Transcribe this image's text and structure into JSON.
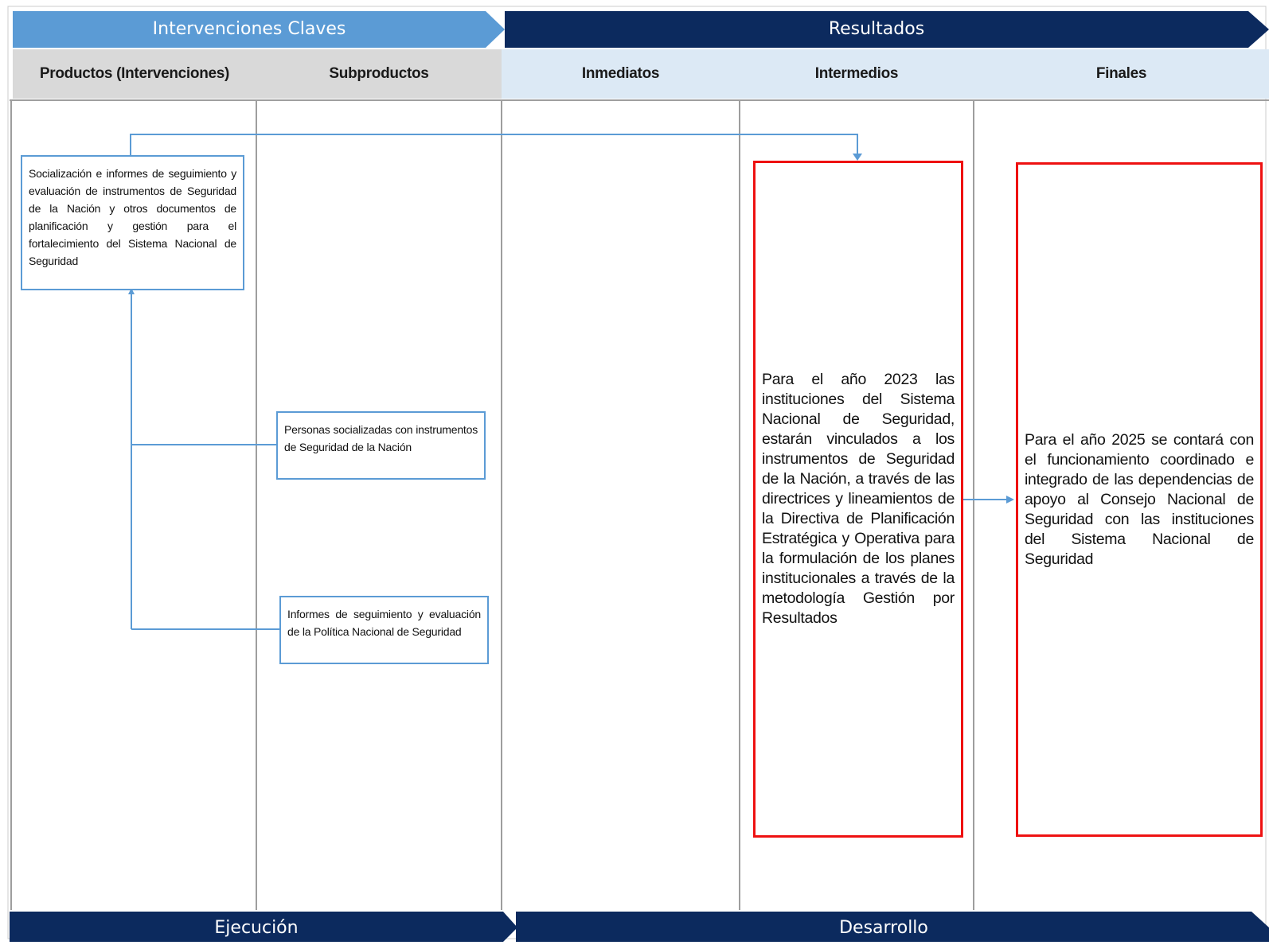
{
  "header": {
    "left_bar": "Intervenciones Claves",
    "right_bar": "Resultados"
  },
  "columns": {
    "productos": "Productos (Intervenciones)",
    "subproductos": "Subproductos",
    "inmediatos": "Inmediatos",
    "intermedios": "Intermedios",
    "finales": "Finales"
  },
  "boxes": {
    "producto": "Socialización e informes de seguimiento y evaluación de instrumentos de Seguridad de la Nación y otros documentos de planificación y gestión para el fortalecimiento del Sistema Nacional de Seguridad",
    "subproducto_1": "Personas socializadas con instrumentos de Seguridad de la Nación",
    "subproducto_2": "Informes de seguimiento y evaluación de la Política Nacional de Seguridad",
    "intermedio": "Para el año 2023 las instituciones del Sistema Nacional de Seguridad, estarán vinculados a los instrumentos de Seguridad de la Nación, a través de las directrices y lineamientos de la Directiva de Planificación Estratégica y Operativa para la formulación de los planes institucionales a través de la metodología Gestión por Resultados",
    "final": "Para el año 2025 se contará con el funcionamiento coordinado e integrado de las dependencias de apoyo al Consejo Nacional de Seguridad con las instituciones del Sistema Nacional de Seguridad"
  },
  "footer": {
    "left_bar": "Ejecución",
    "right_bar": "Desarrollo"
  },
  "colors": {
    "header_light_blue": "#5b9bd5",
    "header_navy": "#0c2a5e",
    "column_gray": "#d9d9d9",
    "column_pale_blue": "#dce9f5",
    "box_blue_border": "#5b9bd5",
    "box_red_border": "#ee1111",
    "connector": "#5b9bd5",
    "divider": "#9e9e9e"
  }
}
